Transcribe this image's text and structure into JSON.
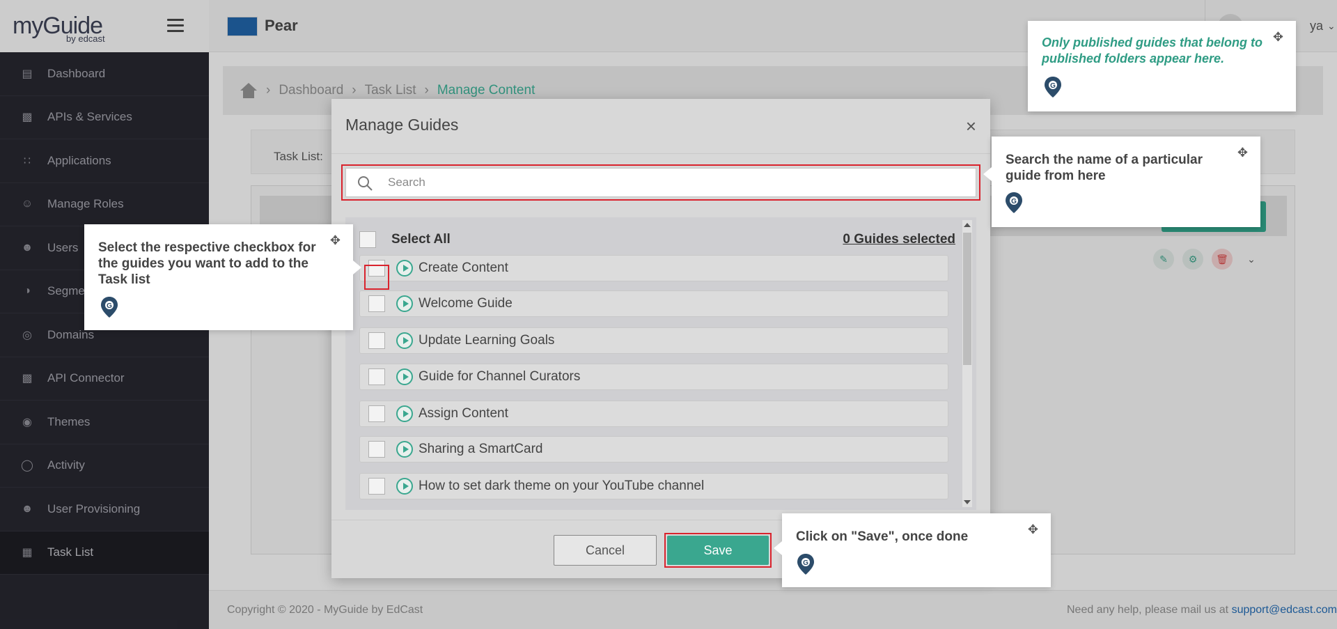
{
  "app": {
    "logo_main": "myGuide",
    "logo_sub": "by edcast",
    "org_name": "Pear",
    "user_name": "ya"
  },
  "sidebar": {
    "items": [
      {
        "label": "Dashboard",
        "icon": "dashboard-icon"
      },
      {
        "label": "APIs & Services",
        "icon": "api-icon"
      },
      {
        "label": "Applications",
        "icon": "grid-icon"
      },
      {
        "label": "Manage Roles",
        "icon": "roles-icon"
      },
      {
        "label": "Users",
        "icon": "users-icon"
      },
      {
        "label": "Segme",
        "icon": "segments-icon"
      },
      {
        "label": "Domains",
        "icon": "globe-icon"
      },
      {
        "label": "API Connector",
        "icon": "api-connector-icon"
      },
      {
        "label": "Themes",
        "icon": "palette-icon"
      },
      {
        "label": "Activity",
        "icon": "activity-icon"
      },
      {
        "label": "User Provisioning",
        "icon": "user-provisioning-icon"
      },
      {
        "label": "Task List",
        "icon": "clipboard-icon",
        "active": true
      }
    ]
  },
  "breadcrumb": {
    "items": [
      "Dashboard",
      "Task List",
      "Manage Content"
    ]
  },
  "main": {
    "task_list_label": "Task List:"
  },
  "footer": {
    "copyright": "Copyright © 2020 - MyGuide by EdCast",
    "help_text": "Need any help, please mail us at",
    "help_email": "support@edcast.com"
  },
  "modal": {
    "title": "Manage Guides",
    "close": "×",
    "search_placeholder": "Search",
    "select_all": "Select All",
    "selected_count": "0 Guides selected",
    "guides": [
      "Create Content",
      "Welcome Guide",
      "Update Learning Goals",
      "Guide for Channel Curators",
      "Assign Content",
      "Sharing a SmartCard",
      "How to set dark theme on your YouTube channel"
    ],
    "cancel_label": "Cancel",
    "save_label": "Save"
  },
  "tooltips": {
    "published": "Only published guides that belong to published folders appear here.",
    "search": "Search the name of a particular guide from here",
    "checkbox": "Select the respective checkbox for the guides you want to add to the Task list",
    "save": "Click on \"Save\", once done"
  },
  "colors": {
    "accent": "#3aa78f",
    "highlight": "#d9232d",
    "sidebar": "#25252d"
  }
}
